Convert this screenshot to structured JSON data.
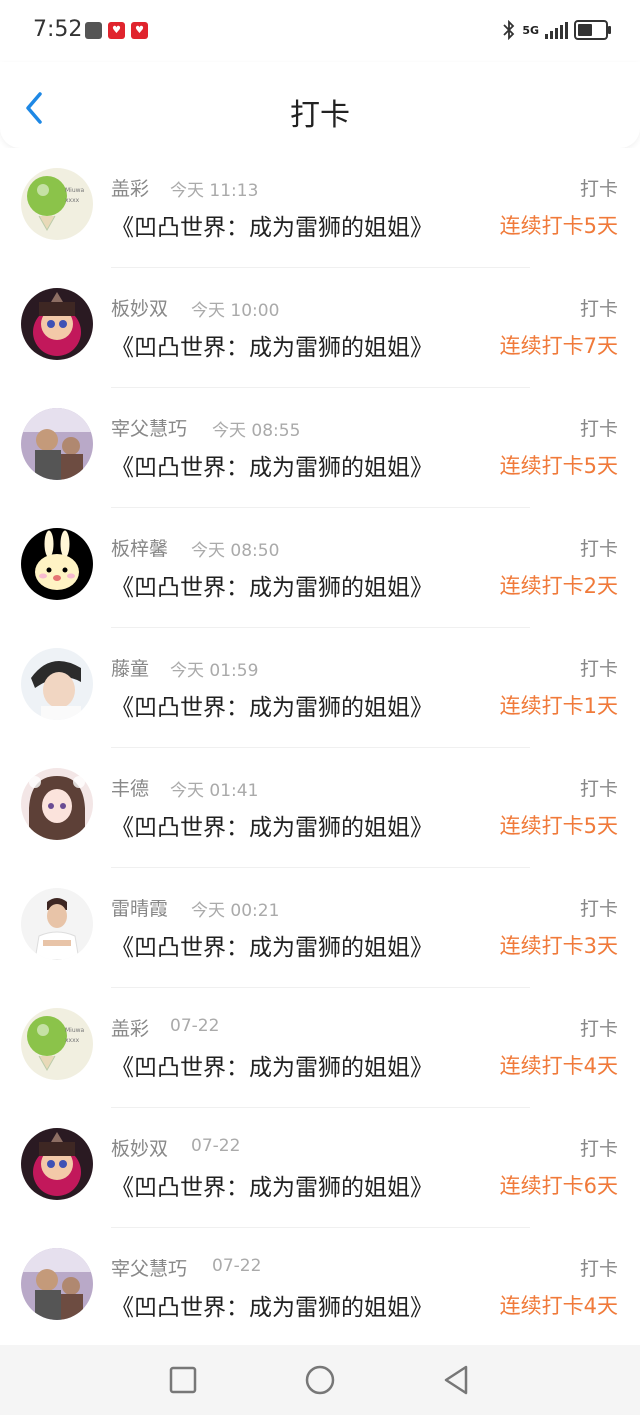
{
  "status_bar": {
    "time": "7:52",
    "network": "5G",
    "notification_icons": [
      "notification-gray-icon",
      "notification-red-icon",
      "notification-red-icon"
    ]
  },
  "header": {
    "title": "打卡",
    "back_icon": "chevron-left-icon",
    "accent_color": "#1e88e5"
  },
  "colors": {
    "streak": "#f07a3a",
    "meta": "#888888",
    "title": "#222222"
  },
  "items": [
    {
      "user": "盖彩",
      "time": "今天 11:13",
      "book": "《凹凸世界：成为雷狮的姐姐》",
      "action": "打卡",
      "streak": "连续打卡5天",
      "avatar": "lime-avatar"
    },
    {
      "user": "板妙双",
      "time": "今天 10:00",
      "book": "《凹凸世界：成为雷狮的姐姐》",
      "action": "打卡",
      "streak": "连续打卡7天",
      "avatar": "anime-red-avatar"
    },
    {
      "user": "宰父慧巧",
      "time": "今天 08:55",
      "book": "《凹凸世界：成为雷狮的姐姐》",
      "action": "打卡",
      "streak": "连续打卡5天",
      "avatar": "photo-avatar"
    },
    {
      "user": "板梓馨",
      "time": "今天 08:50",
      "book": "《凹凸世界：成为雷狮的姐姐》",
      "action": "打卡",
      "streak": "连续打卡2天",
      "avatar": "bunny-avatar"
    },
    {
      "user": "藤童",
      "time": "今天 01:59",
      "book": "《凹凸世界：成为雷狮的姐姐》",
      "action": "打卡",
      "streak": "连续打卡1天",
      "avatar": "boy-avatar"
    },
    {
      "user": "丰德",
      "time": "今天 01:41",
      "book": "《凹凸世界：成为雷狮的姐姐》",
      "action": "打卡",
      "streak": "连续打卡5天",
      "avatar": "doll-avatar"
    },
    {
      "user": "雷晴霞",
      "time": "今天 00:21",
      "book": "《凹凸世界：成为雷狮的姐姐》",
      "action": "打卡",
      "streak": "连续打卡3天",
      "avatar": "man-avatar"
    },
    {
      "user": "盖彩",
      "time": "07-22",
      "book": "《凹凸世界：成为雷狮的姐姐》",
      "action": "打卡",
      "streak": "连续打卡4天",
      "avatar": "lime-avatar"
    },
    {
      "user": "板妙双",
      "time": "07-22",
      "book": "《凹凸世界：成为雷狮的姐姐》",
      "action": "打卡",
      "streak": "连续打卡6天",
      "avatar": "anime-red-avatar"
    },
    {
      "user": "宰父慧巧",
      "time": "07-22",
      "book": "《凹凸世界：成为雷狮的姐姐》",
      "action": "打卡",
      "streak": "连续打卡4天",
      "avatar": "photo-avatar"
    }
  ],
  "nav": {
    "buttons": [
      "square-icon",
      "circle-icon",
      "triangle-back-icon"
    ]
  }
}
